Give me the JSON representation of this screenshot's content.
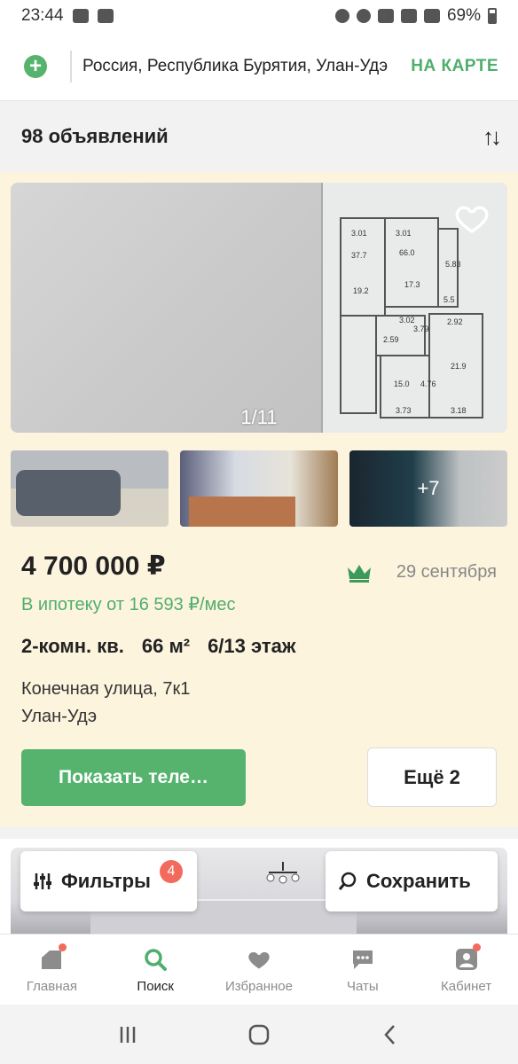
{
  "status_bar": {
    "time": "23:44",
    "battery": "69%"
  },
  "search_bar": {
    "query": "Россия, Республика Бурятия, Улан-Удэ",
    "map_button": "НА КАРТЕ"
  },
  "results": {
    "count": "98 объявлений"
  },
  "listing": {
    "photo_counter": "1/11",
    "more_photos": "+7",
    "price": "4 700 000 ₽",
    "date": "29 сентября",
    "mortgage": "В ипотеку от 16 593 ₽/мес",
    "rooms": "2-комн. кв.",
    "area": "66 м²",
    "floor": "6/13 этаж",
    "address_street": "Конечная улица, 7к1",
    "address_city": "Улан-Удэ",
    "phone_button": "Показать теле…",
    "more_button": "Ещё 2",
    "plan_text": [
      "3.01",
      "37.7",
      "3.01",
      "66.0",
      "5.83",
      "19.2",
      "17.3",
      "5.5",
      "3.02",
      "2.59",
      "3.79",
      "2.92",
      "15.0",
      "4.76",
      "21.9",
      "3.73",
      "3.18"
    ]
  },
  "floating_buttons": {
    "filters": "Фильтры",
    "filters_badge": "4",
    "save": "Сохранить"
  },
  "bottom_nav": [
    {
      "label": "Главная"
    },
    {
      "label": "Поиск"
    },
    {
      "label": "Избранное"
    },
    {
      "label": "Чаты"
    },
    {
      "label": "Кабинет"
    }
  ],
  "colors": {
    "accent_green": "#55b36e",
    "card_background": "#fdf4de",
    "badge_red": "#f26a5b"
  }
}
